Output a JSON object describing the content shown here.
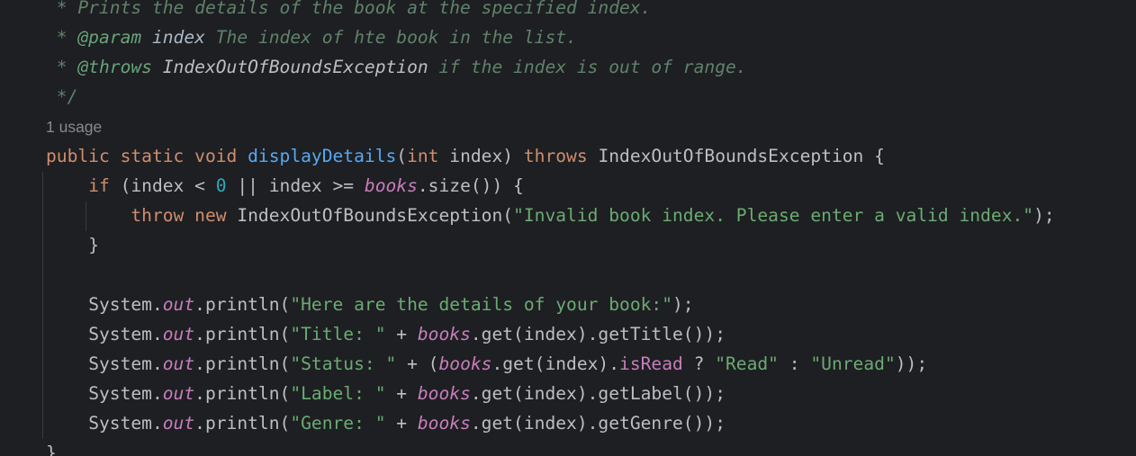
{
  "editor": {
    "language": "Java",
    "usage_hint": "1 usage",
    "doc_comment": {
      "line1": {
        "prefix": " * ",
        "text": "Prints the details of the book at the specified index."
      },
      "line2": {
        "prefix": " * ",
        "tag": "@param",
        "param": "index",
        "text": "The index of hte book in the list."
      },
      "line3": {
        "prefix": " * ",
        "tag": "@throws",
        "exception": "IndexOutOfBoundsException",
        "text": "if the index is out of range."
      },
      "line4": {
        "text": " */"
      }
    },
    "code": {
      "signature": {
        "kw_public": "public",
        "kw_static": "static",
        "kw_void": "void",
        "method_name": "displayDetails",
        "paren_open": "(",
        "kw_int": "int",
        "param": " index",
        "paren_close": ")",
        "kw_throws": "throws",
        "exception": "IndexOutOfBoundsException",
        "brace": "{"
      },
      "if_line": {
        "kw_if": "if",
        "cond_start": "(index < ",
        "zero": "0",
        "cond_mid": " || index >= ",
        "field": "books",
        "cond_end": ".size()) {"
      },
      "throw_line": {
        "kw_throw": "throw",
        "kw_new": "new",
        "exception": "IndexOutOfBoundsException(",
        "message": "\"Invalid book index. Please enter a valid index.\"",
        "end": ");"
      },
      "close_if": "}",
      "println_lines": [
        {
          "receiver": "System.",
          "field": "out",
          "call": ".println(",
          "string": "\"Here are the details of your book:\"",
          "end": ");"
        },
        {
          "receiver": "System.",
          "field": "out",
          "call": ".println(",
          "string": "\"Title: \"",
          "plus": " + ",
          "books": "books",
          "end": ".get(index).getTitle());"
        },
        {
          "receiver": "System.",
          "field": "out",
          "call": ".println(",
          "string": "\"Status: \"",
          "plus": " + (",
          "books": "books",
          "get": ".get(index).",
          "is_read": "isRead",
          "ternary_q": " ? ",
          "read": "\"Read\"",
          "ternary_c": " : ",
          "unread": "\"Unread\"",
          "end": "));"
        },
        {
          "receiver": "System.",
          "field": "out",
          "call": ".println(",
          "string": "\"Label: \"",
          "plus": " + ",
          "books": "books",
          "end": ".get(index).getLabel());"
        },
        {
          "receiver": "System.",
          "field": "out",
          "call": ".println(",
          "string": "\"Genre: \"",
          "plus": " + ",
          "books": "books",
          "end": ".get(index).getGenre());"
        }
      ],
      "close_method": "}"
    },
    "colors": {
      "background": "#1e1f22",
      "keyword": "#cf8e6d",
      "method": "#56a8f5",
      "string": "#6aab73",
      "number": "#2aacb8",
      "field": "#c77dbb",
      "comment": "#5f826b",
      "text": "#bcbec4"
    }
  }
}
